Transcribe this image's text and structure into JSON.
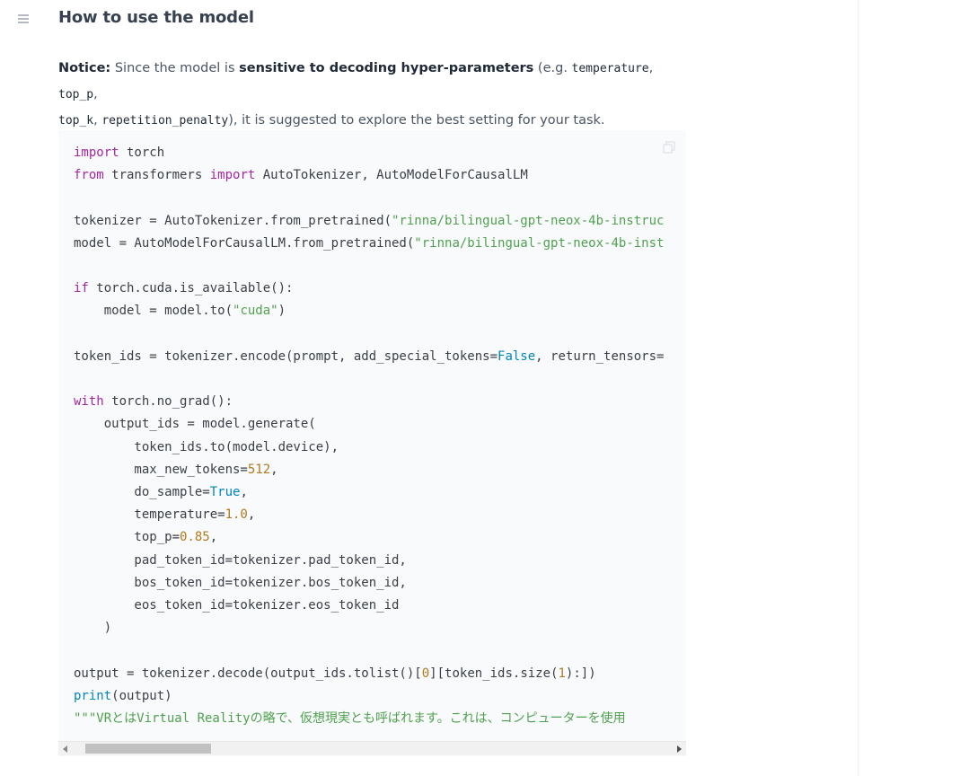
{
  "heading": "How to use the model",
  "notice": {
    "label": "Notice:",
    "t1": " Since the model is ",
    "emphasis": "sensitive to decoding hyper-parameters",
    "t2": " (e.g. ",
    "p1": "temperature",
    "sep": ", ",
    "p2": "top_p",
    "p3": "top_k",
    "p4": "repetition_penalty",
    "t3": "), it is suggested to explore the best setting for your task."
  },
  "code": {
    "l01": [
      {
        "c": "kw",
        "t": "import"
      },
      {
        "t": " torch"
      }
    ],
    "l02": [
      {
        "c": "kw",
        "t": "from"
      },
      {
        "t": " transformers "
      },
      {
        "c": "kw",
        "t": "import"
      },
      {
        "t": " AutoTokenizer, AutoModelForCausalLM"
      }
    ],
    "l03": [],
    "l04": [
      {
        "t": "tokenizer = AutoTokenizer.from_pretrained("
      },
      {
        "c": "st",
        "t": "\"rinna/bilingual-gpt-neox-4b-instruc"
      }
    ],
    "l05": [
      {
        "t": "model = AutoModelForCausalLM.from_pretrained("
      },
      {
        "c": "st",
        "t": "\"rinna/bilingual-gpt-neox-4b-inst"
      }
    ],
    "l06": [],
    "l07": [
      {
        "c": "kw",
        "t": "if"
      },
      {
        "t": " torch.cuda.is_available():"
      }
    ],
    "l08": [
      {
        "t": "    model = model.to("
      },
      {
        "c": "st",
        "t": "\"cuda\""
      },
      {
        "t": ")"
      }
    ],
    "l09": [],
    "l10": [
      {
        "t": "token_ids = tokenizer.encode(prompt, add_special_tokens="
      },
      {
        "c": "bi",
        "t": "False"
      },
      {
        "t": ", return_tensors="
      }
    ],
    "l11": [],
    "l12": [
      {
        "c": "kw",
        "t": "with"
      },
      {
        "t": " torch.no_grad():"
      }
    ],
    "l13": [
      {
        "t": "    output_ids = model.generate("
      }
    ],
    "l14": [
      {
        "t": "        token_ids.to(model.device),"
      }
    ],
    "l15": [
      {
        "t": "        max_new_tokens="
      },
      {
        "c": "nm",
        "t": "512"
      },
      {
        "t": ","
      }
    ],
    "l16": [
      {
        "t": "        do_sample="
      },
      {
        "c": "bi",
        "t": "True"
      },
      {
        "t": ","
      }
    ],
    "l17": [
      {
        "t": "        temperature="
      },
      {
        "c": "nm",
        "t": "1.0"
      },
      {
        "t": ","
      }
    ],
    "l18": [
      {
        "t": "        top_p="
      },
      {
        "c": "nm",
        "t": "0.85"
      },
      {
        "t": ","
      }
    ],
    "l19": [
      {
        "t": "        pad_token_id=tokenizer.pad_token_id,"
      }
    ],
    "l20": [
      {
        "t": "        bos_token_id=tokenizer.bos_token_id,"
      }
    ],
    "l21": [
      {
        "t": "        eos_token_id=tokenizer.eos_token_id"
      }
    ],
    "l22": [
      {
        "t": "    )"
      }
    ],
    "l23": [],
    "l24": [
      {
        "t": "output = tokenizer.decode(output_ids.tolist()["
      },
      {
        "c": "nm",
        "t": "0"
      },
      {
        "t": "][token_ids.size("
      },
      {
        "c": "nm",
        "t": "1"
      },
      {
        "t": "):])"
      }
    ],
    "l25": [
      {
        "c": "bi",
        "t": "print"
      },
      {
        "t": "(output)"
      }
    ],
    "l26": [
      {
        "c": "st",
        "t": "\"\"\"VRとはVirtual Realityの略で、仮想現実とも呼ばれます。これは、コンピューターを使用"
      }
    ]
  },
  "scroll": {
    "position": 0.02,
    "visible_fraction": 0.21
  }
}
